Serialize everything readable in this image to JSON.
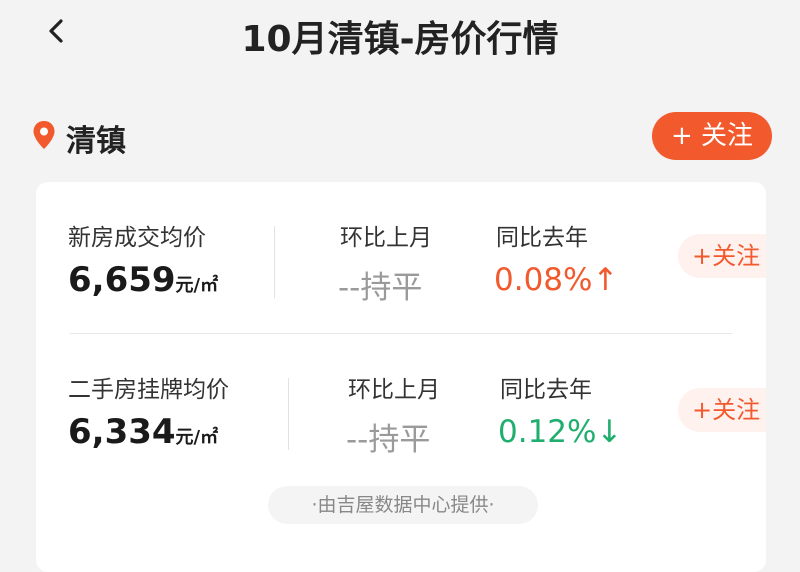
{
  "header": {
    "back_icon": "chevron-left-icon",
    "title": "10月清镇-房价行情"
  },
  "location": {
    "icon": "map-pin-icon",
    "name": "清镇",
    "follow_label": "+ 关注",
    "accent_color": "#f2592d"
  },
  "new_house": {
    "label": "新房成交均价",
    "price": "6,659",
    "unit": "元/㎡",
    "mom_label": "环比上月",
    "mom_value": "--持平",
    "yoy_label": "同比去年",
    "yoy_value": "0.08%↑",
    "yoy_color": "#f2592d",
    "follow_label": "+关注"
  },
  "second_hand": {
    "label": "二手房挂牌均价",
    "price": "6,334",
    "unit": "元/㎡",
    "mom_label": "环比上月",
    "mom_value": "--持平",
    "yoy_label": "同比去年",
    "yoy_value": "0.12%↓",
    "yoy_color": "#1fae6e",
    "follow_label": "+关注"
  },
  "source": "·由吉屋数据中心提供·"
}
